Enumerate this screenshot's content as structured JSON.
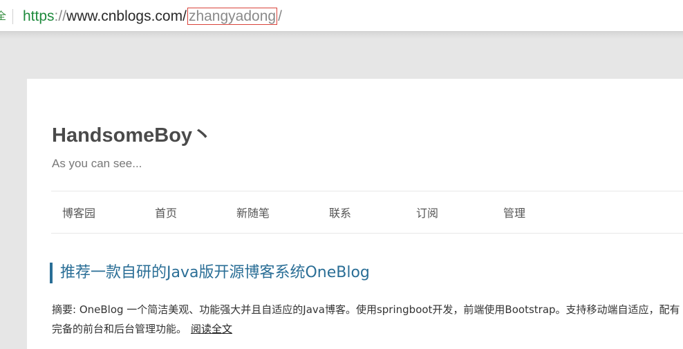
{
  "address_bar": {
    "security_glyph": "全",
    "url_scheme": "https",
    "url_separator": "://",
    "url_host": "www.cnblogs.com/",
    "url_path": "zhangyadong",
    "url_trailing": "/"
  },
  "blog": {
    "title": "HandsomeBoy丶",
    "subtitle": "As you can see..."
  },
  "nav": {
    "items": [
      {
        "label": "博客园"
      },
      {
        "label": "首页"
      },
      {
        "label": "新随笔"
      },
      {
        "label": "联系"
      },
      {
        "label": "订阅"
      },
      {
        "label": "管理"
      }
    ]
  },
  "post": {
    "title": "推荐一款自研的Java版开源博客系统OneBlog",
    "summary": "摘要: OneBlog 一个简洁美观、功能强大并且自适应的Java博客。使用springboot开发，前端使用Bootstrap。支持移动端自适应，配有完备的前台和后台管理功能。",
    "read_more_label": "阅读全文"
  },
  "colors": {
    "accent": "#2a6e96",
    "url_highlight_border": "#d9423a",
    "scheme_green": "#1e8a3c"
  }
}
